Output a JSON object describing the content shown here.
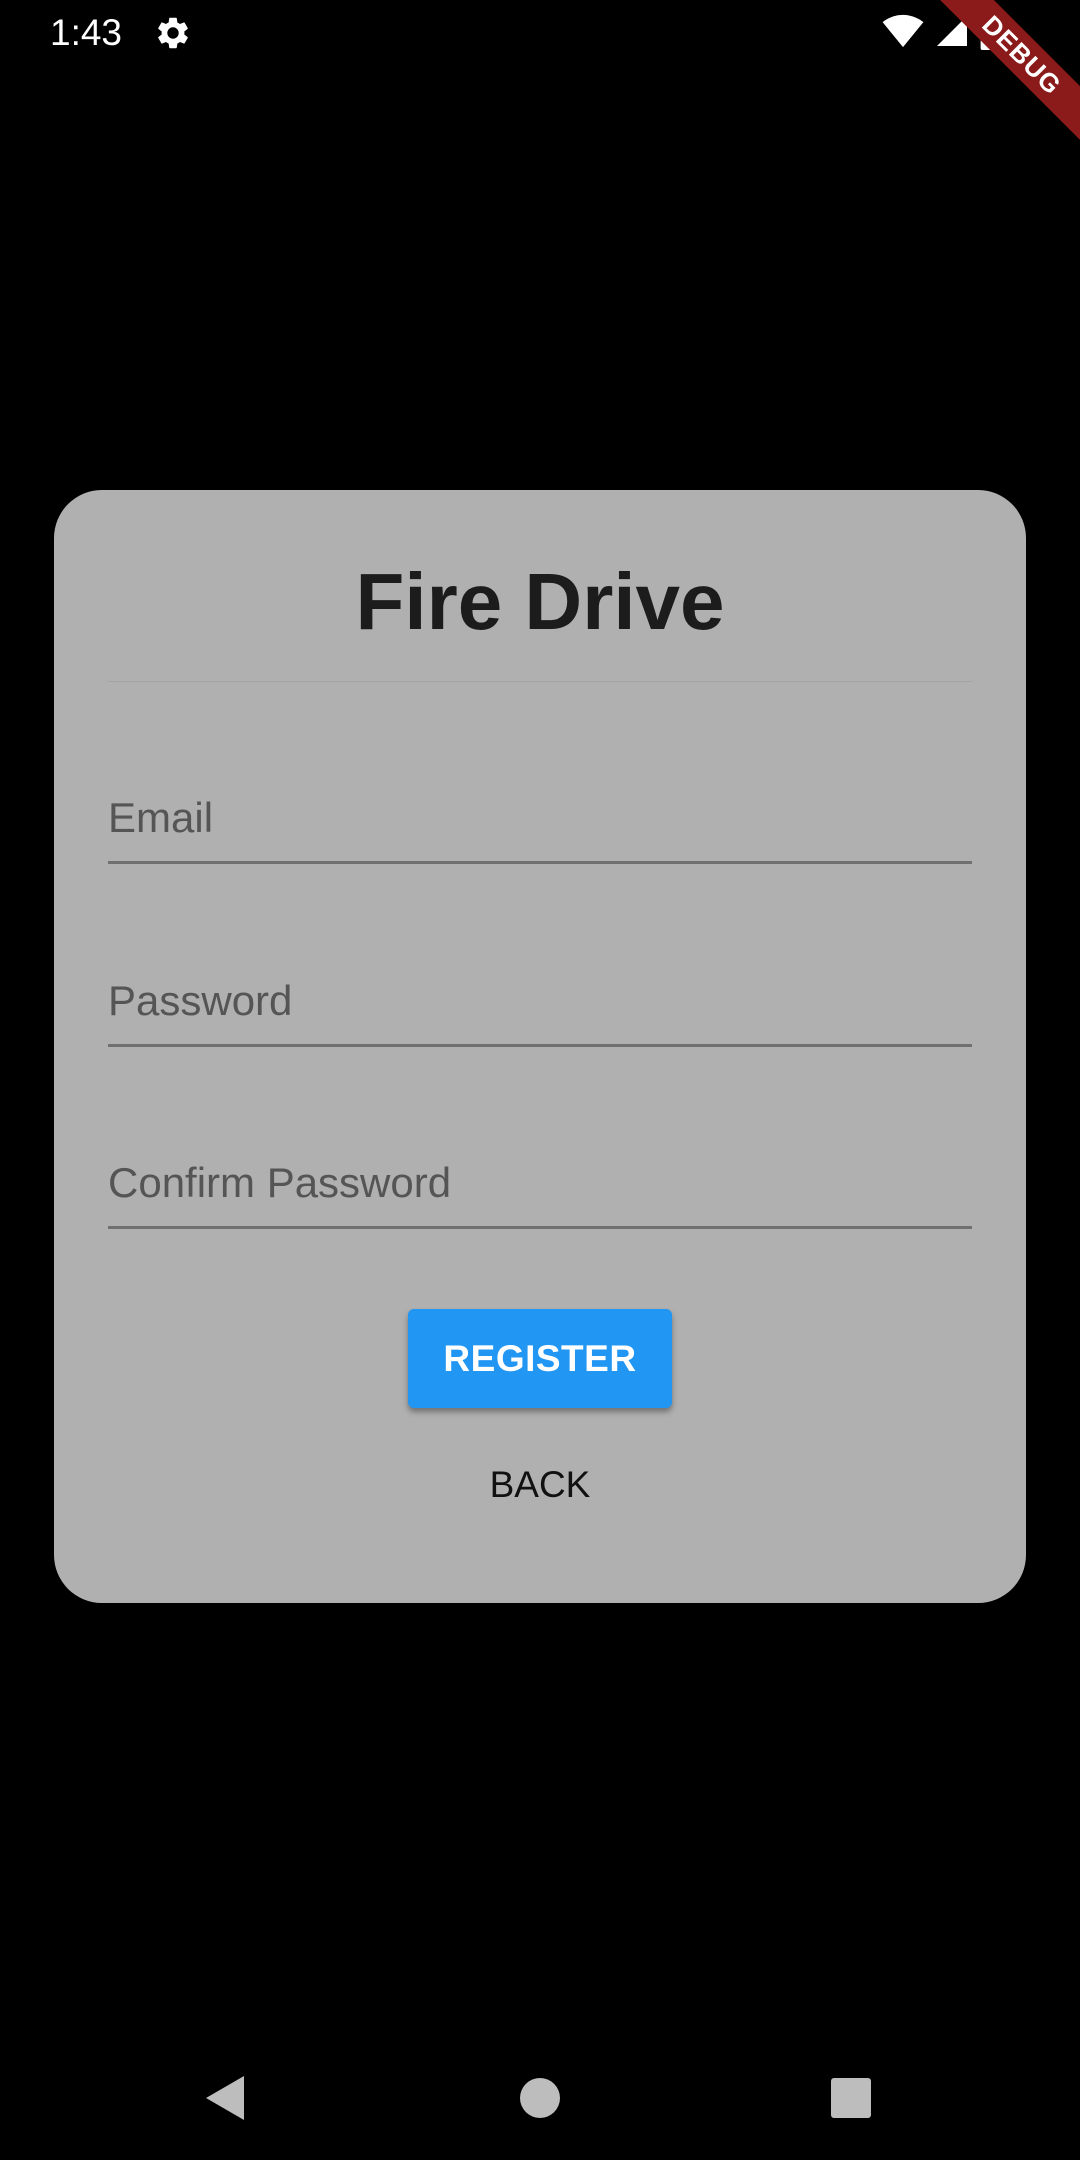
{
  "status_bar": {
    "time": "1:43",
    "icons": [
      "gear-icon",
      "wifi-icon",
      "cell-signal-icon",
      "battery-icon"
    ],
    "debug_label": "DEBUG"
  },
  "card": {
    "title": "Fire Drive",
    "background_color": "#b0b0b0",
    "fields": {
      "email": {
        "placeholder": "Email",
        "value": ""
      },
      "password": {
        "placeholder": "Password",
        "value": ""
      },
      "confirm_password": {
        "placeholder": "Confirm Password",
        "value": ""
      }
    },
    "register_label": "REGISTER",
    "register_color": "#2196f3",
    "back_label": "BACK"
  },
  "nav_bar": {
    "icons": [
      "back-triangle-icon",
      "home-circle-icon",
      "recents-square-icon"
    ]
  }
}
